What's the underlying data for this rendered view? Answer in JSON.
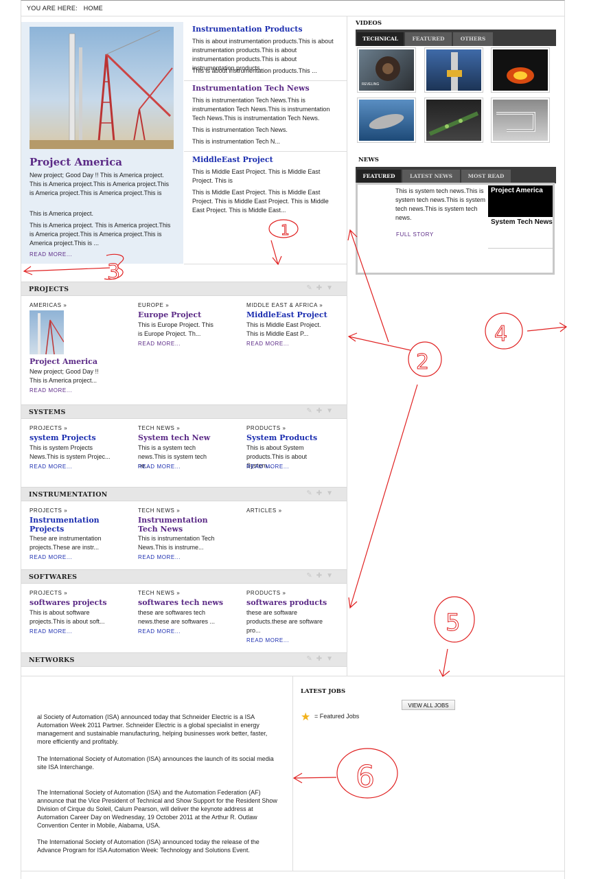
{
  "breadcrumb": {
    "prefix": "YOU ARE HERE:",
    "home": "HOME"
  },
  "hero": {
    "title": "Project America",
    "p1": "New project; Good Day !! This is America project. This is America project.This is America project.This is America project.This is America project.This is",
    "p2": "This is America project.",
    "p3": "This is America project. This is America project.This is America project.This is America project.This is America project.This is ...",
    "more": "READ MORE..."
  },
  "mid_list": [
    {
      "title": "Instrumentation Products",
      "p1": "This is about instrumentation products.This is about instrumentation products.This is about instrumentation products.This is about instrumentation products.",
      "p2": "This is about instrumentation products.This ..."
    },
    {
      "title": "Instrumentation Tech News",
      "p1": "This is instrumentation Tech News.This is instrumentation Tech News.This is instrumentation Tech News.This is instrumentation Tech News.",
      "p2": "This is instrumentation Tech News.",
      "p3": "This is instrumentation Tech N..."
    },
    {
      "title": "MiddleEast Project",
      "p1": "This is Middle East Project. This is Middle East Project. This is",
      "p2": "This is Middle East Project. This is Middle East Project. This is Middle East Project. This is Middle East Project. This is Middle East..."
    }
  ],
  "sections": [
    {
      "title": "PROJECTS",
      "cols": [
        {
          "cat": "AMERICAS",
          "title": "Project America",
          "text": "New project; Good Day !! This is America project...",
          "more": "READ MORE...",
          "has_img": true
        },
        {
          "cat": "EUROPE",
          "title": "Europe Project",
          "text": "This is Europe Project. This is Europe Project. Th...",
          "more": "READ MORE..."
        },
        {
          "cat": "MIDDLE EAST & AFRICA",
          "title": "MiddleEast Project",
          "text": "This is Middle East Project. This is Middle East P...",
          "more": "READ MORE..."
        }
      ]
    },
    {
      "title": "SYSTEMS",
      "cols": [
        {
          "cat": "PROJECTS",
          "title": "system Projects",
          "text": "This is system Projects News.This is system Projec...",
          "more": "READ MORE..."
        },
        {
          "cat": "TECH NEWS",
          "title": "System tech New",
          "text": "This is a  system tech news.This is system tech ne...",
          "more": "READ MORE..."
        },
        {
          "cat": "PRODUCTS",
          "title": "System Products",
          "text": "This is about System products.This is about System...",
          "more": "READ MORE..."
        }
      ]
    },
    {
      "title": "INSTRUMENTATION",
      "cols": [
        {
          "cat": "PROJECTS",
          "title": "Instrumentation Projects",
          "text": "These are instrumentation projects.These are instr...",
          "more": "READ MORE..."
        },
        {
          "cat": "TECH NEWS",
          "title": "Instrumentation Tech News",
          "text": "This is instrumentation Tech News.This is instrume...",
          "more": "READ MORE..."
        },
        {
          "cat": "ARTICLES",
          "title": "",
          "text": "",
          "more": ""
        }
      ]
    },
    {
      "title": "SOFTWARES",
      "cols": [
        {
          "cat": "PROJECTS",
          "title": "softwares projects",
          "text": "This is about software projects.This is about soft...",
          "more": "READ MORE..."
        },
        {
          "cat": "TECH NEWS",
          "title": "softwares tech news",
          "text": "these are softwares tech news.these are softwares ...",
          "more": "READ MORE..."
        },
        {
          "cat": "PRODUCTS",
          "title": "softwares products",
          "text": "these are software products.these are software pro...",
          "more": "READ MORE..."
        }
      ]
    },
    {
      "title": "NETWORKS",
      "cols": []
    }
  ],
  "videos": {
    "title": "VIDEOS",
    "tabs": [
      "TECHNICAL",
      "FEATURED",
      "OTHERS"
    ],
    "active_tab": 0,
    "thumb_text": "REVELING"
  },
  "news": {
    "title": "NEWS",
    "tabs": [
      "FEATURED",
      "LATEST NEWS",
      "MOST READ"
    ],
    "active_tab": 0,
    "body": "This is system tech news.This is system tech news.This is system tech news.This is system tech news.",
    "link": "FULL STORY",
    "items": [
      "Project America",
      "System Tech News"
    ]
  },
  "feed": [
    "al Society of Automation (ISA) announced today that Schneider Electric is a ISA Automation Week 2011 Partner. Schneider Electric is a global specialist in energy management and sustainable manufacturing, helping businesses work better, faster, more efficiently and profitably.",
    "The International Society of Automation (ISA) announces the launch of its social media site ISA Interchange.",
    "The International Society of Automation (ISA) and the Automation Federation (AF) announce that the Vice President of Technical and Show Support for the Resident Show Division of Cirque du Soleil, Calum Pearson, will deliver the keynote address at Automation Career Day on Wednesday, 19 October 2011 at the Arthur R. Outlaw Convention Center in Mobile, Alabama, USA.",
    "The International Society of Automation (ISA) announced today the release of the Advance Program for ISA Automation Week: Technology and Solutions Event."
  ],
  "jobs": {
    "title": "LATEST JOBS",
    "button": "VIEW ALL JOBS",
    "legend": "= Featured Jobs"
  },
  "annotations": [
    "1",
    "2",
    "3",
    "4",
    "5",
    "6"
  ],
  "colors": {
    "purple": "#5b2a86",
    "blue": "#1d2fb0",
    "annotation": "#e02020",
    "tabbar": "#3b3b3b"
  }
}
